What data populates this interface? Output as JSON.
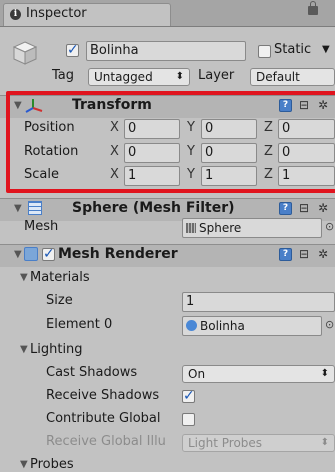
{
  "tab": {
    "icon": "info-icon",
    "label": "Inspector"
  },
  "object": {
    "icon": "cube-icon",
    "name": "Bolinha",
    "active": true,
    "static_label": "Static",
    "static": false,
    "tag_label": "Tag",
    "tag_value": "Untagged",
    "layer_label": "Layer",
    "layer_value": "Default"
  },
  "transform": {
    "title": "Transform",
    "rows": [
      {
        "label": "Position",
        "x": "0",
        "y": "0",
        "z": "0"
      },
      {
        "label": "Rotation",
        "x": "0",
        "y": "0",
        "z": "0"
      },
      {
        "label": "Scale",
        "x": "1",
        "y": "1",
        "z": "1"
      }
    ],
    "axis": {
      "x": "X",
      "y": "Y",
      "z": "Z"
    }
  },
  "mesh_filter": {
    "title": "Sphere (Mesh Filter)",
    "mesh_label": "Mesh",
    "mesh_value": "Sphere"
  },
  "mesh_renderer": {
    "title": "Mesh Renderer",
    "enabled": true,
    "materials_label": "Materials",
    "size_label": "Size",
    "size_value": "1",
    "element0_label": "Element 0",
    "element0_value": "Bolinha",
    "lighting_label": "Lighting",
    "cast_shadows_label": "Cast Shadows",
    "cast_shadows_value": "On",
    "receive_shadows_label": "Receive Shadows",
    "receive_shadows": true,
    "contribute_gi_label": "Contribute Global",
    "contribute_gi": false,
    "receive_gi_label": "Receive Global Illu",
    "receive_gi_value": "Light Probes",
    "probes_label": "Probes"
  },
  "colors": {
    "highlight": "#e0141e",
    "panel": "#c2c2c2",
    "header": "#b4b4b4"
  }
}
